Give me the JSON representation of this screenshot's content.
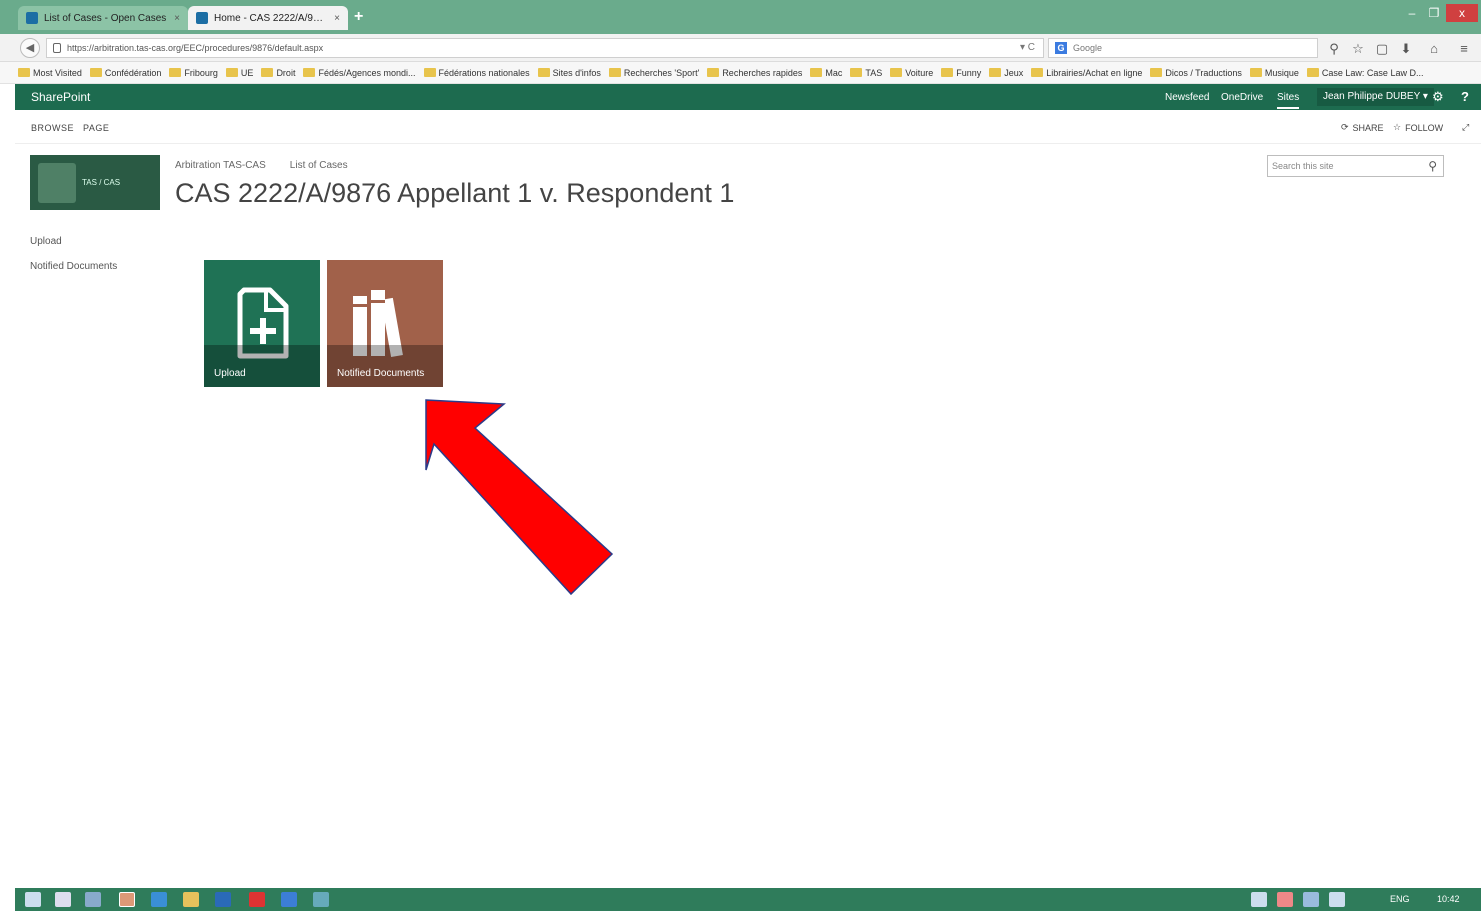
{
  "browser": {
    "tabs": [
      {
        "title": "List of Cases - Open Cases",
        "close": "×"
      },
      {
        "title": "Home - CAS 2222/A/9876 ...",
        "close": "×"
      }
    ],
    "new_tab": "+",
    "window_controls": {
      "minimize": "–",
      "maximize": "❐",
      "close": "x"
    },
    "back": "◀",
    "url": "https://arbitration.tas-cas.org/EEC/procedures/9876/default.aspx",
    "reload": "▾ C",
    "search_engine": "G",
    "search_placeholder": "Google",
    "toolbar_icons": [
      "search-icon",
      "star-icon",
      "clipboard-icon",
      "download-icon",
      "home-icon",
      "menu-icon"
    ],
    "bookmarks": [
      "Most Visited",
      "Confédération",
      "Fribourg",
      "UE",
      "Droit",
      "Fédés/Agences mondi...",
      "Fédérations nationales",
      "Sites d'infos",
      "Recherches 'Sport'",
      "Recherches rapides",
      "Mac",
      "TAS",
      "Voiture",
      "Funny",
      "Jeux",
      "Librairies/Achat en ligne",
      "Dicos / Traductions",
      "Musique",
      "Case Law: Case Law D..."
    ]
  },
  "suite": {
    "brand": "SharePoint",
    "links": [
      "Newsfeed",
      "OneDrive",
      "Sites"
    ],
    "selected_link": "Sites",
    "user": "Jean Philippe DUBEY ▾",
    "settings": "⚙",
    "help": "?"
  },
  "ribbon": {
    "tabs": [
      "BROWSE",
      "PAGE"
    ],
    "share": "SHARE",
    "follow": "FOLLOW",
    "focus": "⤢"
  },
  "site": {
    "logo_text": "TAS / CAS",
    "breadcrumb": [
      "Arbitration TAS-CAS",
      "List of Cases"
    ],
    "title": "CAS 2222/A/9876 Appellant 1 v. Respondent 1",
    "search_placeholder": "Search this site"
  },
  "quicklaunch": [
    "Upload",
    "Notified Documents"
  ],
  "tiles": [
    {
      "label": "Upload",
      "color": "#1f7255",
      "icon": "add-document-icon"
    },
    {
      "label": "Notified Documents",
      "color": "#a1614a",
      "icon": "books-icon"
    }
  ],
  "annotation": {
    "color": "#ff0000",
    "icon": "arrow-icon"
  },
  "taskbar": {
    "lang": "ENG",
    "time": "10:42"
  }
}
